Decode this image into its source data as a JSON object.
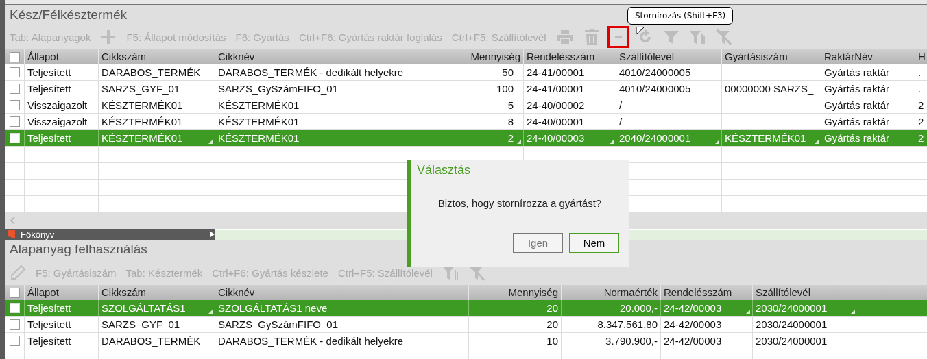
{
  "top_panel": {
    "title": "Kész/Félkésztermék",
    "toolbar": [
      {
        "kind": "text",
        "label": "Tab: Alapanyagok"
      },
      {
        "kind": "add"
      },
      {
        "kind": "text",
        "label": "F5: Állapot módosítás"
      },
      {
        "kind": "text",
        "label": "F6: Gyártás"
      },
      {
        "kind": "text",
        "label": "Ctrl+F6: Gyártás raktár foglalás"
      },
      {
        "kind": "text",
        "label": "Ctrl+F5: Szállítólevél"
      },
      {
        "kind": "print"
      },
      {
        "kind": "delete"
      },
      {
        "kind": "storno",
        "highlighted": true
      },
      {
        "kind": "refresh"
      },
      {
        "kind": "filter"
      },
      {
        "kind": "filter-bars"
      },
      {
        "kind": "filter-clear"
      }
    ],
    "tooltip": "Stornírozás (Shift+F3)",
    "table": {
      "header_checked": false,
      "columns": [
        "Állapot",
        "Cikkszám",
        "Cikknév",
        "Mennyiség",
        "Rendelésszám",
        "Szállítólevél",
        "Gyártásiszám",
        "RaktárNév",
        "H"
      ],
      "rows": [
        {
          "checked": false,
          "selected": false,
          "cells": [
            "Teljesített",
            "DARABOS_TERMÉK",
            "DARABOS_TERMÉK - dedikált helyekre",
            "50",
            "24-41/00001",
            "4010/24000005",
            "",
            "Gyártás raktár",
            "."
          ]
        },
        {
          "checked": false,
          "selected": false,
          "cells": [
            "Teljesített",
            "SARZS_GYF_01",
            "SARZS_GySzámFIFO_01",
            "100",
            "24-41/00001",
            "4010/24000005",
            "00000000 SARZS_",
            "Gyártás raktár",
            "."
          ]
        },
        {
          "checked": false,
          "selected": false,
          "cells": [
            "Visszaigazolt",
            "KÉSZTERMÉK01",
            "KÉSZTERMÉK01",
            "5",
            "24-40/00002",
            "/",
            "",
            "Gyártás raktár",
            "2"
          ]
        },
        {
          "checked": false,
          "selected": false,
          "cells": [
            "Visszaigazolt",
            "KÉSZTERMÉK01",
            "KÉSZTERMÉK01",
            "8",
            "24-40/00001",
            "/",
            "",
            "Gyártás raktár",
            "2"
          ]
        },
        {
          "checked": false,
          "selected": true,
          "cells": [
            "Teljesített",
            "KÉSZTERMÉK01",
            "KÉSZTERMÉK01",
            "2",
            "24-40/00003",
            "2040/24000001",
            "KÉSZTERMÉK01",
            "Gyártás raktár",
            "2"
          ]
        }
      ]
    }
  },
  "background_menu": {
    "label": "Főkönyv"
  },
  "bottom_panel": {
    "title": "Alapanyag felhasználás",
    "toolbar": [
      {
        "kind": "edit"
      },
      {
        "kind": "text",
        "label": "F5: Gyártásiszám"
      },
      {
        "kind": "text",
        "label": "Tab: Késztermék"
      },
      {
        "kind": "text",
        "label": "Ctrl+F6: Gyártás készlete"
      },
      {
        "kind": "text",
        "label": "Ctrl+F5: Szállítólevél"
      },
      {
        "kind": "filter-bars"
      },
      {
        "kind": "filter-clear"
      }
    ],
    "table": {
      "header_checked": false,
      "columns": [
        "Állapot",
        "Cikkszám",
        "Cikknév",
        "Mennyiség",
        "Normaérték",
        "Rendelésszám",
        "Szállítólevél"
      ],
      "rows": [
        {
          "checked": false,
          "selected": true,
          "cells": [
            "Teljesített",
            "SZOLGÁLTATÁS1",
            "SZOLGÁLTATÁS1 neve",
            "20",
            "20.000,-",
            "24-42/00003",
            "2030/24000001"
          ]
        },
        {
          "checked": false,
          "selected": false,
          "cells": [
            "Teljesített",
            "SARZS_GYF_01",
            "SARZS_GySzámFIFO_01",
            "20",
            "8.347.561,80",
            "24-42/00003",
            "2030/24000001"
          ]
        },
        {
          "checked": false,
          "selected": false,
          "cells": [
            "Teljesített",
            "DARABOS_TERMÉK",
            "DARABOS_TERMÉK - dedikált helyekre",
            "10",
            "3.790.900,-",
            "24-42/00003",
            "2030/24000001"
          ]
        }
      ]
    }
  },
  "dialog": {
    "title": "Választás",
    "message": "Biztos, hogy stornírozza a gyártást?",
    "buttons": [
      {
        "label": "Igen",
        "default": false
      },
      {
        "label": "Nem",
        "default": true
      }
    ]
  }
}
